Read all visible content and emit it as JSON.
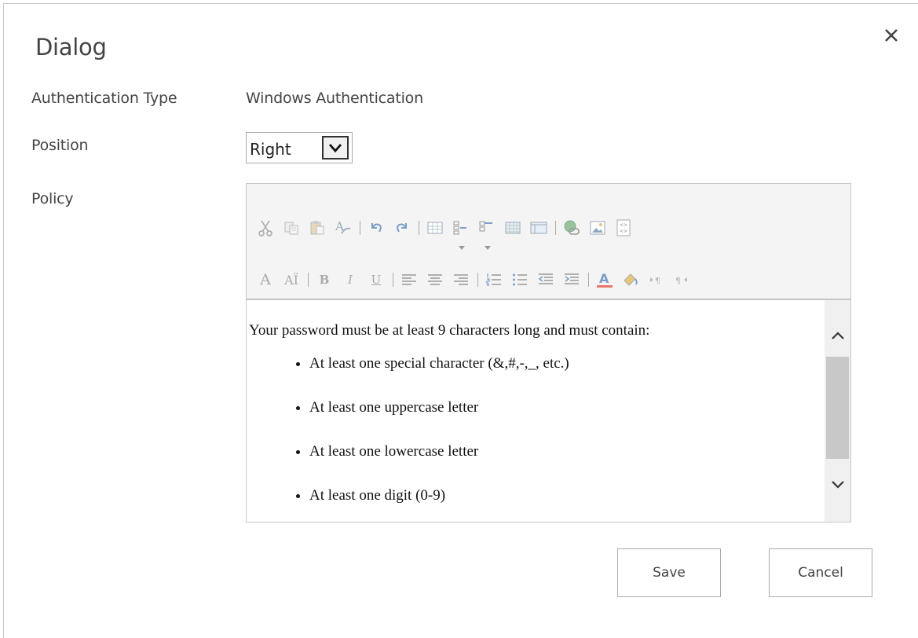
{
  "dialog": {
    "title": "Dialog",
    "close_icon": "close-icon"
  },
  "form": {
    "auth_type_label": "Authentication Type",
    "auth_type_value": "Windows Authentication",
    "position_label": "Position",
    "position_value": "Right",
    "policy_label": "Policy"
  },
  "toolbar": {
    "row1_icons": [
      "cut-icon",
      "copy-icon",
      "paste-icon",
      "spellcheck-icon",
      "undo-icon",
      "redo-icon",
      "table-icon",
      "insert-row-icon",
      "insert-column-icon",
      "grid-icon",
      "layout-icon",
      "link-icon",
      "image-icon",
      "embed-icon"
    ],
    "row2_icons": [
      "font-icon",
      "font-size-icon",
      "bold-icon",
      "italic-icon",
      "underline-icon",
      "align-left-icon",
      "align-center-icon",
      "align-right-icon",
      "numbered-list-icon",
      "bullet-list-icon",
      "outdent-icon",
      "indent-icon",
      "font-color-icon",
      "highlight-icon",
      "ltr-icon",
      "rtl-icon"
    ],
    "bold_glyph": "B",
    "italic_glyph": "I",
    "underline_glyph": "U",
    "font_glyph": "A",
    "font_size_glyph": "AÏ"
  },
  "editor": {
    "intro": "Your password must be at least 9 characters long and must contain:",
    "items": [
      "At least one special character (&,#,-,_, etc.)",
      "At least one uppercase letter",
      "At least one lowercase letter",
      "At least one digit (0-9)"
    ]
  },
  "buttons": {
    "save": "Save",
    "cancel": "Cancel"
  },
  "colors": {
    "toolbar_bg": "#f4f4f4",
    "border": "#c6c6c6",
    "icon_gray": "#b8b8b8",
    "font_color_bar": "#e8756b"
  }
}
